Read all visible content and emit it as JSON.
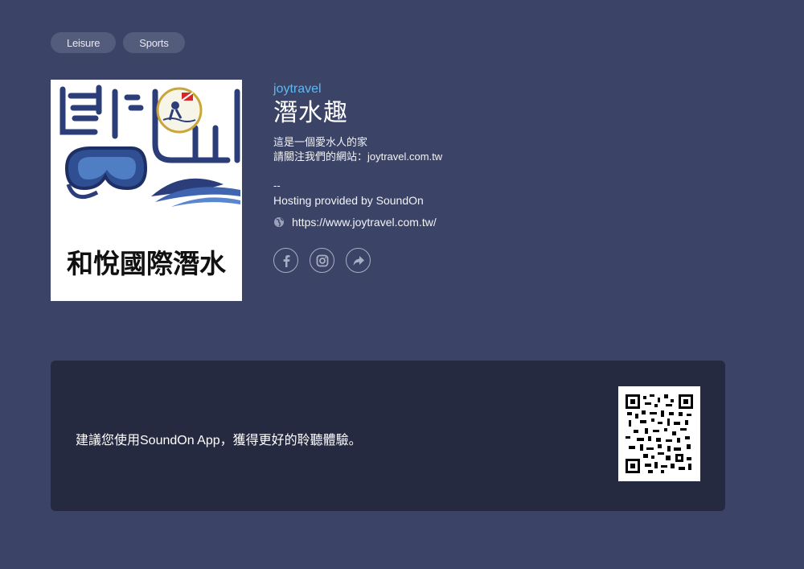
{
  "tags": [
    "Leisure",
    "Sports"
  ],
  "podcast": {
    "author": "joytravel",
    "title": "潛水趣",
    "description": "這是一個愛水人的家\n請關注我們的網站：joytravel.com.tw\n\n--",
    "hosting": "Hosting provided by SoundOn",
    "website": "https://www.joytravel.com.tw/"
  },
  "cover": {
    "logo_text": "和悅國際潛水"
  },
  "socials": [
    {
      "icon": "facebook-icon"
    },
    {
      "icon": "instagram-icon"
    },
    {
      "icon": "share-icon"
    }
  ],
  "banner": {
    "text": "建議您使用SoundOn App，獲得更好的聆聽體驗。"
  },
  "colors": {
    "background": "#3b4466",
    "tag_bg": "#545c7c",
    "author": "#5fb7f4",
    "banner_bg": "#262a40",
    "logo_navy": "#2c3e7a"
  }
}
